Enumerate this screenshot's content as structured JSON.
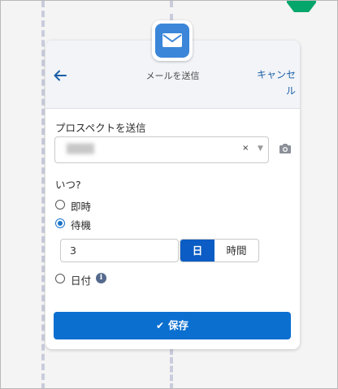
{
  "header": {
    "title": "メールを送信",
    "cancel_label": "キャンセル"
  },
  "form": {
    "prospect_label": "プロスペクトを送信",
    "prospect_value": "████",
    "clear_symbol": "×",
    "caret_symbol": "▼",
    "when_label": "いつ?",
    "options": {
      "immediate": "即時",
      "wait": "待機",
      "date": "日付"
    },
    "selected_option": "wait",
    "wait_value": "3",
    "units": {
      "day": "日",
      "hour": "時間",
      "selected": "day"
    },
    "info_symbol": "i"
  },
  "actions": {
    "save_label": "保存",
    "save_check": "✔"
  },
  "colors": {
    "accent": "#0b6fd0",
    "mail_tile": "#3b86d8",
    "green_node": "#05a66b"
  },
  "icons": {
    "back": "arrow-left-icon",
    "mail": "envelope-icon",
    "camera": "camera-icon",
    "info": "info-icon"
  }
}
